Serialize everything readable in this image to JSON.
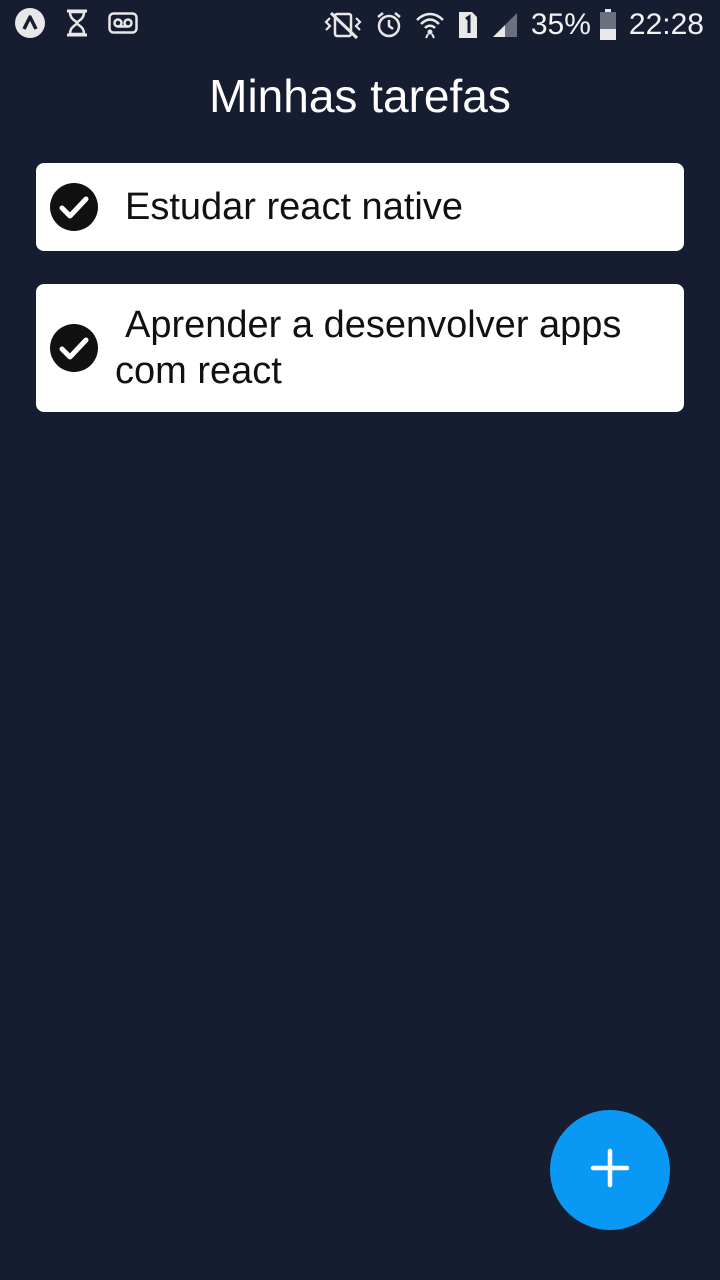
{
  "status_bar": {
    "left_icons": [
      "expo-icon",
      "hourglass-icon",
      "voicemail-icon"
    ],
    "right_icons": [
      "vibrate-icon",
      "alarm-icon",
      "wifi-icon",
      "sim-1-icon",
      "signal-icon"
    ],
    "battery_percent": "35%",
    "time": "22:28"
  },
  "header": {
    "title": "Minhas tarefas"
  },
  "tasks": [
    {
      "icon": "check-circle-icon",
      "label": "Estudar react native",
      "done": true
    },
    {
      "icon": "check-circle-icon",
      "label": "Aprender a desenvolver apps com react",
      "done": true
    }
  ],
  "fab": {
    "icon": "plus-icon",
    "color": "#0a98f5"
  },
  "colors": {
    "background": "#171d31",
    "card": "#ffffff",
    "accent": "#0a98f5"
  }
}
